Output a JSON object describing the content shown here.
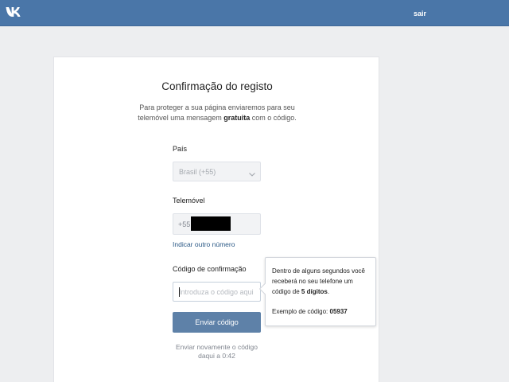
{
  "header": {
    "logo": "vk-logo-icon",
    "logout_label": "sair",
    "bg_color": "#4a76a8"
  },
  "card": {
    "title": "Confirmação do registo",
    "description_line1": "Para proteger a sua página enviaremos para seu telemóvel uma",
    "description_line2_pre": "mensagem ",
    "description_line2_bold": "gratuita",
    "description_line2_post": " com o código."
  },
  "country": {
    "label": "País",
    "value": "Brasil (+55)",
    "icon": "chevron-down-icon"
  },
  "phone": {
    "label": "Telemóvel",
    "prefix": "+55"
  },
  "other_number_link": "Indicar outro número",
  "code": {
    "label": "Código de confirmação",
    "placeholder": "Introduza o código aqui"
  },
  "send_button": "Enviar código",
  "resend_text": "Enviar novamente o código daqui a 0:42",
  "tooltip": {
    "text_pre": "Dentro de alguns segundos você receberá no seu telefone um código de ",
    "text_bold": "5 dígitos",
    "text_post": ".",
    "example_label": "Exemplo de código: ",
    "example_code": "05937"
  }
}
